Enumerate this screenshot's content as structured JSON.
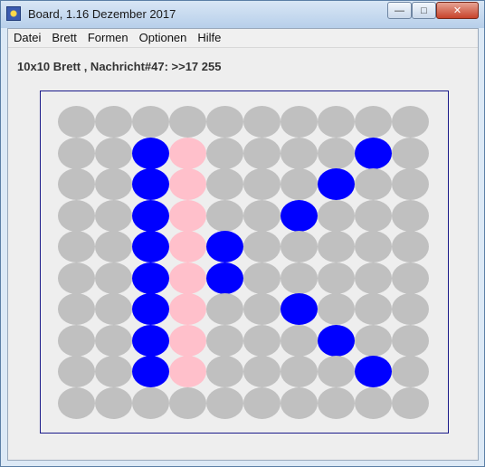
{
  "window": {
    "title": "Board, 1.16 Dezember 2017",
    "controls": {
      "minimize": "—",
      "maximize": "□",
      "close": "✕"
    }
  },
  "menu": {
    "items": [
      "Datei",
      "Brett",
      "Formen",
      "Optionen",
      "Hilfe"
    ]
  },
  "status": {
    "text": "10x10 Brett , Nachricht#47: >>17 255"
  },
  "board": {
    "rows": 10,
    "cols": 10,
    "colors": {
      "empty": "#c0c0c0",
      "blue": "#0000ff",
      "pink": "#ffc0cb"
    },
    "grid": [
      "..........",
      "..BP....B.",
      "..BP...B..",
      "..BP..B...",
      "..BPB.....",
      "..BPB.....",
      "..BP..B...",
      "..BP...B..",
      "..BP....B.",
      ".........."
    ]
  }
}
